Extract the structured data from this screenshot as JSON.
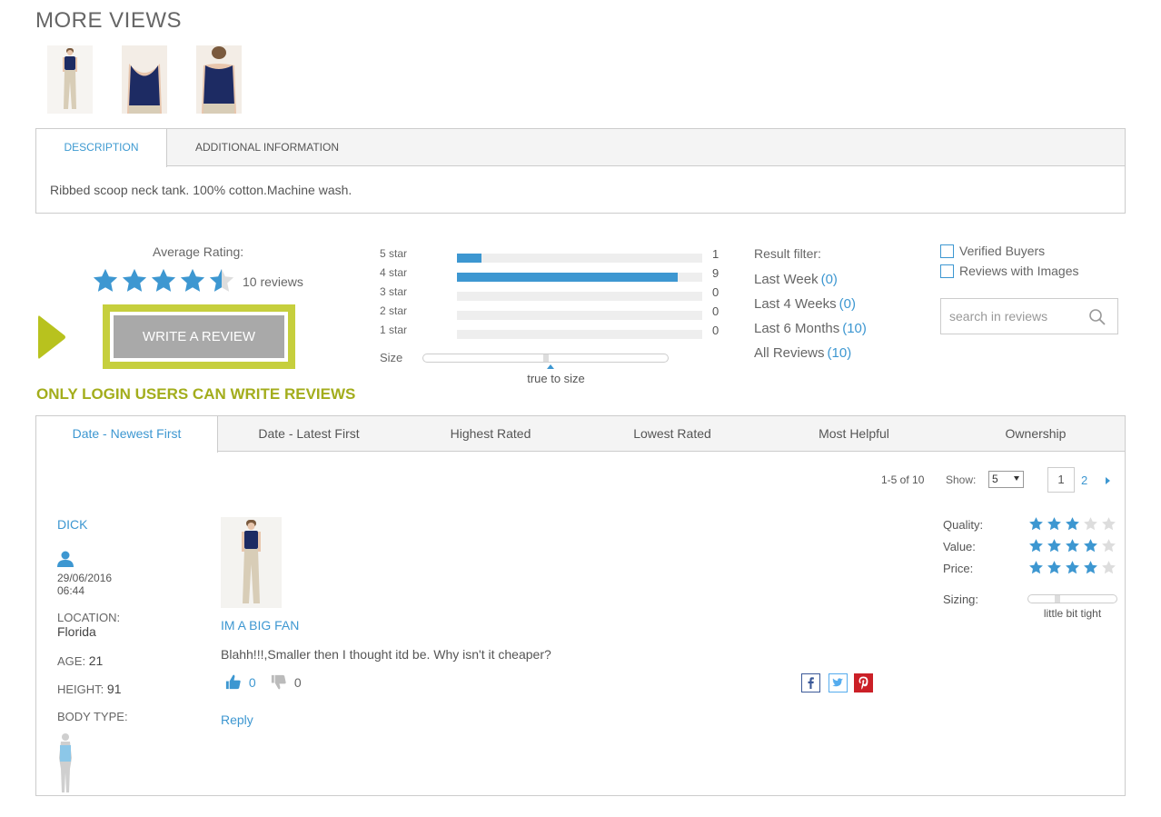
{
  "more_views": {
    "title": "MORE VIEWS",
    "thumbnails": [
      "thumbnail-full-body",
      "thumbnail-front-close",
      "thumbnail-back-close"
    ]
  },
  "product_tabs": {
    "tabs": [
      {
        "label": "DESCRIPTION",
        "active": true
      },
      {
        "label": "ADDITIONAL INFORMATION",
        "active": false
      }
    ],
    "description": "Ribbed scoop neck tank. 100% cotton.Machine wash."
  },
  "summary": {
    "average_label": "Average Rating:",
    "average_rating": 4.5,
    "reviews_count_text": "10 reviews",
    "write_review_label": "WRITE A REVIEW",
    "login_note": "ONLY LOGIN USERS CAN WRITE REVIEWS"
  },
  "histogram": {
    "total": 10,
    "rows": [
      {
        "label": "5 star",
        "count": "1",
        "value": 1
      },
      {
        "label": "4 star",
        "count": "9",
        "value": 9
      },
      {
        "label": "3 star",
        "count": "0",
        "value": 0
      },
      {
        "label": "2 star",
        "count": "0",
        "value": 0
      },
      {
        "label": "1 star",
        "count": "0",
        "value": 0
      }
    ],
    "size_label": "Size",
    "size_value_text": "true to size",
    "size_position": 0.5
  },
  "result_filter": {
    "title": "Result filter:",
    "links": [
      {
        "label": "Last Week",
        "count": "(0)"
      },
      {
        "label": "Last 4 Weeks",
        "count": "(0)"
      },
      {
        "label": "Last 6 Months",
        "count": "(10)"
      },
      {
        "label": "All Reviews",
        "count": "(10)"
      }
    ]
  },
  "options": {
    "verified_label": "Verified Buyers",
    "images_label": "Reviews with Images",
    "search_placeholder": "search in reviews"
  },
  "sort_tabs": [
    {
      "label": "Date - Newest First",
      "active": true
    },
    {
      "label": "Date - Latest First",
      "active": false
    },
    {
      "label": "Highest Rated",
      "active": false
    },
    {
      "label": "Lowest Rated",
      "active": false
    },
    {
      "label": "Most Helpful",
      "active": false
    },
    {
      "label": "Ownership",
      "active": false
    }
  ],
  "pager": {
    "range": "1-5 of 10",
    "show_label": "Show:",
    "show_value": "5",
    "current_page": "1",
    "next_page": "2"
  },
  "review": {
    "name": "DICK",
    "date": "29/06/2016",
    "time": "06:44",
    "location_label": "LOCATION:",
    "location": "Florida",
    "age_label": "AGE:",
    "age": "21",
    "height_label": "HEIGHT:",
    "height": "91",
    "body_type_label": "BODY TYPE:",
    "title": "IM A BIG FAN",
    "text": "Blahh!!!,Smaller then I thought itd be. Why isn't it cheaper?",
    "helpful_count": "0",
    "unhelpful_count": "0",
    "reply_label": "Reply",
    "ratings": [
      {
        "label": "Quality:",
        "value": 3
      },
      {
        "label": "Value:",
        "value": 4
      },
      {
        "label": "Price:",
        "value": 4
      }
    ],
    "sizing_label": "Sizing:",
    "sizing_text": "little bit tight",
    "sizing_position": 0.33
  },
  "colors": {
    "accent_blue": "#3d97d1",
    "lime": "#c6cf3d",
    "note_green": "#a3ad1c",
    "star_empty": "#dddddd",
    "pinterest": "#cb2027"
  }
}
